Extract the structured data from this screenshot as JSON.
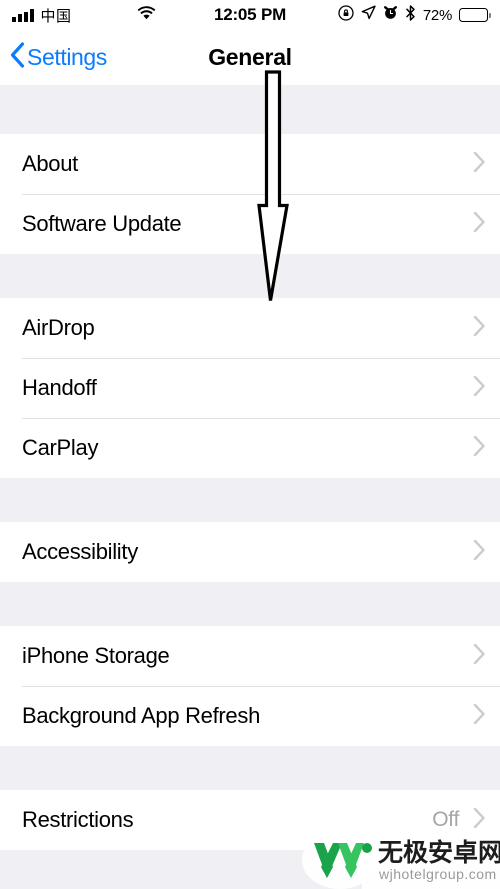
{
  "status_bar": {
    "signal_icon": "signal-bars-icon",
    "signal_bars": 4,
    "carrier": "中国",
    "wifi_icon": "wifi-icon",
    "time": "12:05 PM",
    "rotation_lock_icon": "rotation-lock-icon",
    "location_icon": "location-arrow-icon",
    "alarm_icon": "alarm-clock-icon",
    "bluetooth_icon": "bluetooth-icon",
    "battery_percent": "72%",
    "battery_icon": "battery-icon",
    "battery_level": 72
  },
  "nav_bar": {
    "back_label": "Settings",
    "back_icon": "chevron-left-icon",
    "title": "General"
  },
  "sections": [
    {
      "rows": [
        {
          "label": "About",
          "value": "",
          "accessory": "chevron-right-icon"
        },
        {
          "label": "Software Update",
          "value": "",
          "accessory": "chevron-right-icon"
        }
      ]
    },
    {
      "rows": [
        {
          "label": "AirDrop",
          "value": "",
          "accessory": "chevron-right-icon"
        },
        {
          "label": "Handoff",
          "value": "",
          "accessory": "chevron-right-icon"
        },
        {
          "label": "CarPlay",
          "value": "",
          "accessory": "chevron-right-icon"
        }
      ]
    },
    {
      "rows": [
        {
          "label": "Accessibility",
          "value": "",
          "accessory": "chevron-right-icon"
        }
      ]
    },
    {
      "rows": [
        {
          "label": "iPhone Storage",
          "value": "",
          "accessory": "chevron-right-icon"
        },
        {
          "label": "Background App Refresh",
          "value": "",
          "accessory": "chevron-right-icon"
        }
      ]
    },
    {
      "rows": [
        {
          "label": "Restrictions",
          "value": "Off",
          "accessory": "chevron-right-icon"
        }
      ]
    }
  ],
  "annotation": {
    "type": "down-arrow",
    "color": "#000000",
    "fill": "#ffffff"
  },
  "watermark": {
    "logo_icon": "w-logo-icon",
    "site_name": "无极安卓网",
    "site_url": "wjhotelgroup.com",
    "color_dark": "#1aa34a",
    "color_light": "#35c45f"
  },
  "colors": {
    "accent": "#0a7cff",
    "group_background": "#efeff4",
    "row_background": "#ffffff",
    "separator": "#d4d4d8",
    "secondary_text": "#a5a5aa"
  }
}
